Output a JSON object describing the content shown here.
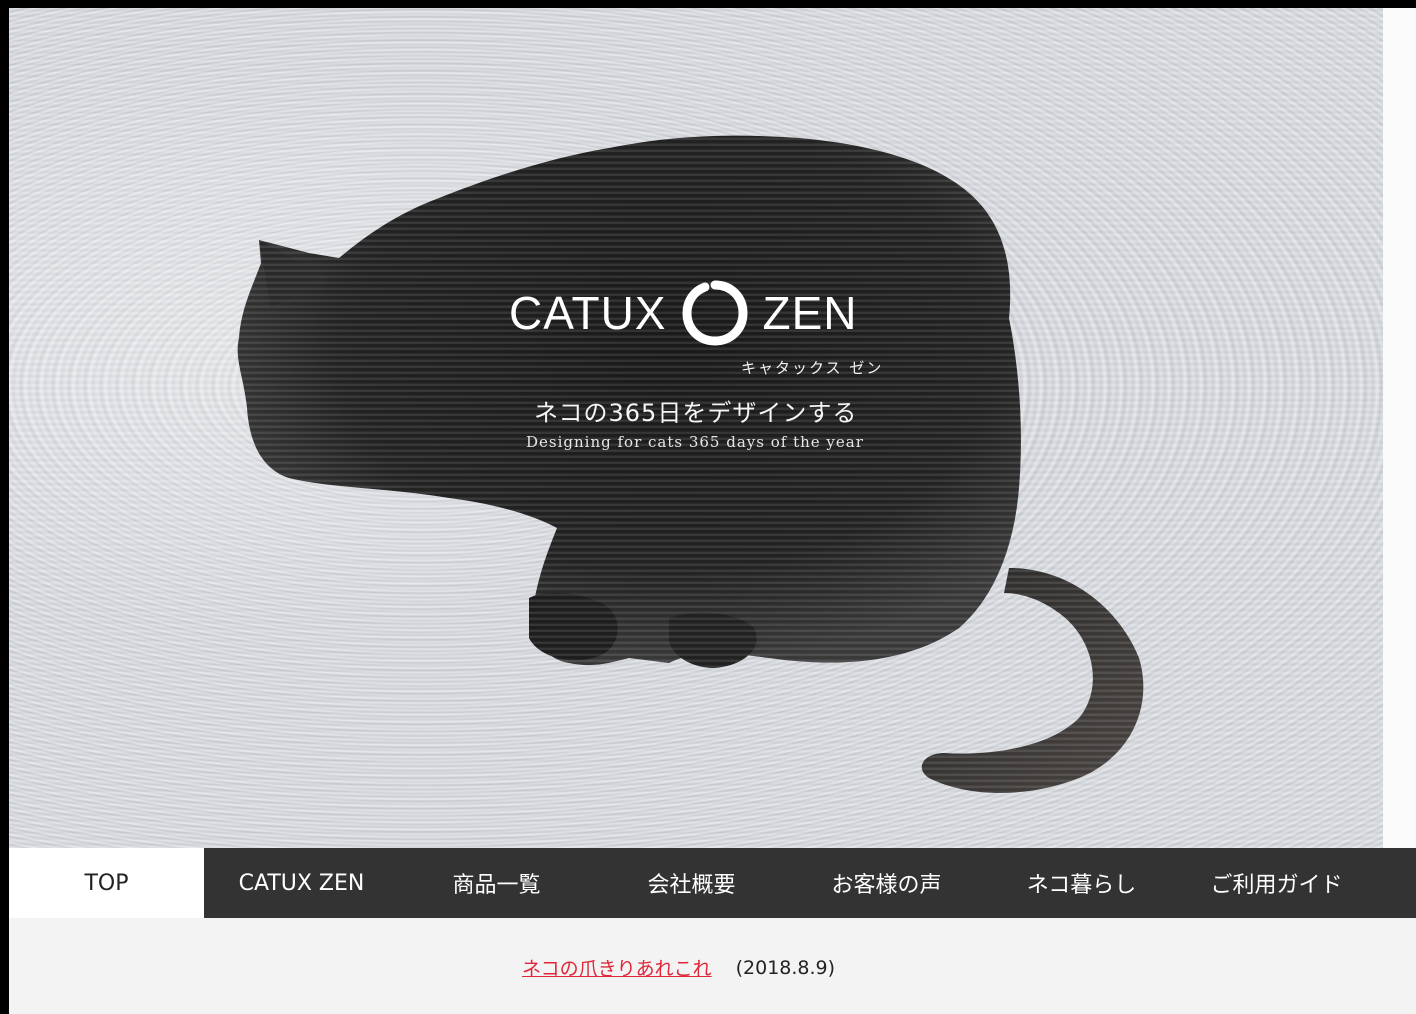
{
  "brand": {
    "name_left": "CATUX",
    "name_right": "ZEN",
    "kana": "キャタックス ゼン",
    "tagline_jp": "ネコの365日をデザインする",
    "tagline_en": "Designing for cats 365 days of the year"
  },
  "nav": {
    "items": [
      {
        "label": "TOP",
        "active": true
      },
      {
        "label": "CATUX ZEN"
      },
      {
        "label": "商品一覧"
      },
      {
        "label": "会社概要"
      },
      {
        "label": "お客様の声"
      },
      {
        "label": "ネコ暮らし"
      },
      {
        "label": "ご利用ガイド"
      }
    ]
  },
  "news": {
    "link_text": "ネコの爪きりあれこれ",
    "date": "(2018.8.9)"
  },
  "colors": {
    "nav_bg": "#333333",
    "nav_active_bg": "#ffffff",
    "news_link": "#e0263a"
  }
}
